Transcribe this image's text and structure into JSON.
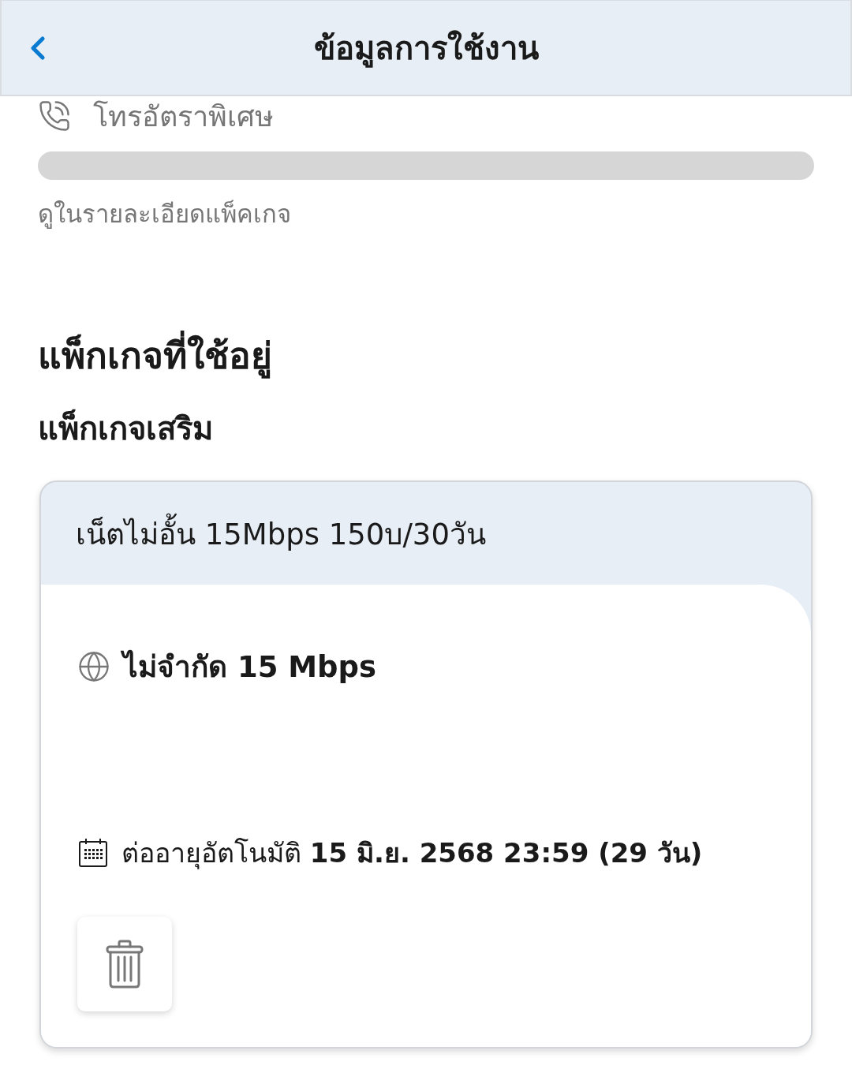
{
  "header": {
    "title": "ข้อมูลการใช้งาน"
  },
  "usage": {
    "label": "โทรอัตราพิเศษ",
    "note": "ดูในรายละเอียดแพ็คเกจ"
  },
  "section_title": "แพ็กเกจที่ใช้อยู่",
  "subsection_title": "แพ็กเกจเสริม",
  "packages": [
    {
      "name": "เน็ตไม่อั้น 15Mbps 150บ/30วัน",
      "benefit": "ไม่จำกัด 15 Mbps",
      "renewal": "ต่ออายุอัตโนมัติ **15 มิ.ย. 2568 23:59 (29 วัน)**"
    }
  ]
}
